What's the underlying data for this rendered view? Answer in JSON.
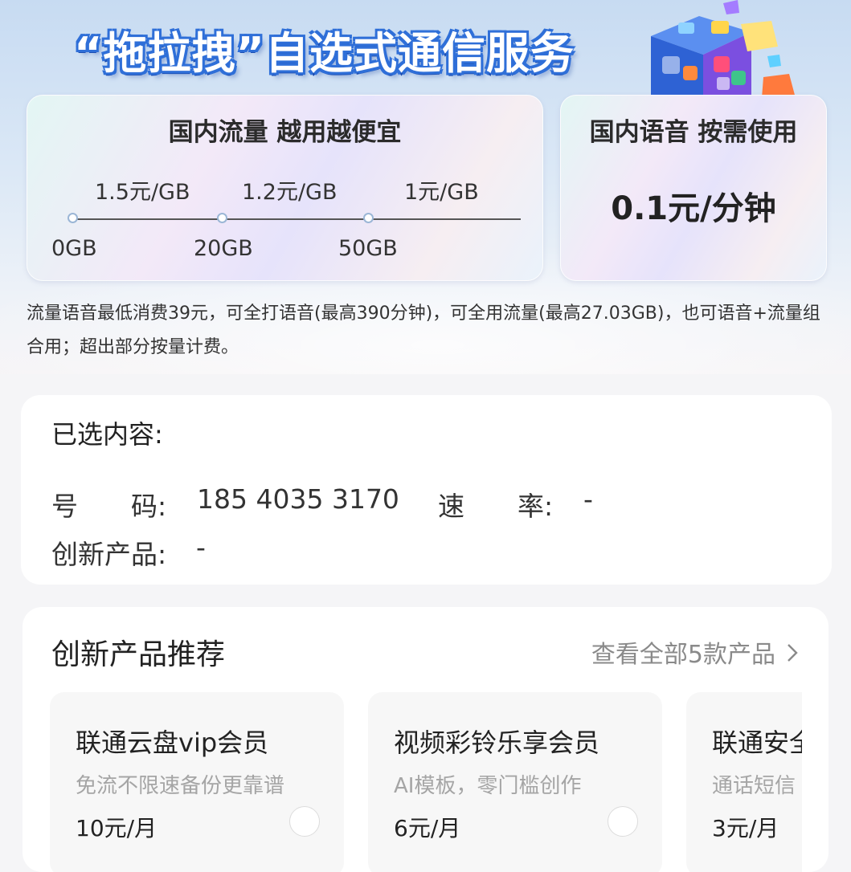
{
  "hero": {
    "title": "“拖拉拽”自选式通信服务",
    "data_card": {
      "heading": "国内流量 越用越便宜",
      "prices": [
        "1.5元/GB",
        "1.2元/GB",
        "1元/GB"
      ],
      "tiers": [
        "0GB",
        "20GB",
        "50GB"
      ]
    },
    "voice_card": {
      "heading": "国内语音 按需使用",
      "price": "0.1元/分钟"
    },
    "note": "流量语音最低消费39元，可全打语音(最高390分钟)，可全用流量(最高27.03GB)，也可语音+流量组合用；超出部分按量计费。"
  },
  "selected": {
    "title": "已选内容:",
    "number_label": "号　　码:",
    "number_value": "185 4035 3170",
    "rate_label": "速　　率:",
    "rate_value": "-",
    "product_label": "创新产品:",
    "product_value": "-"
  },
  "products": {
    "title": "创新产品推荐",
    "view_all": "查看全部5款产品",
    "items": [
      {
        "name": "联通云盘vip会员",
        "desc": "免流不限速备份更靠谱",
        "price": "10元/月"
      },
      {
        "name": "视频彩铃乐享会员",
        "desc": "AI模板，零门槛创作",
        "price": "6元/月"
      },
      {
        "name": "联通安全",
        "desc": "通话短信",
        "price": "3元/月"
      }
    ]
  },
  "colors": {
    "title_fill": "#ffffff",
    "title_outline": "#2f6fd8",
    "page_bg": "#f5f5f7",
    "muted_text": "#8a8a8a"
  },
  "icons": {
    "view_all_chevron": "chevron-right-icon",
    "hero_art": "app-cube-icon",
    "select_control": "radio-unchecked-icon"
  }
}
